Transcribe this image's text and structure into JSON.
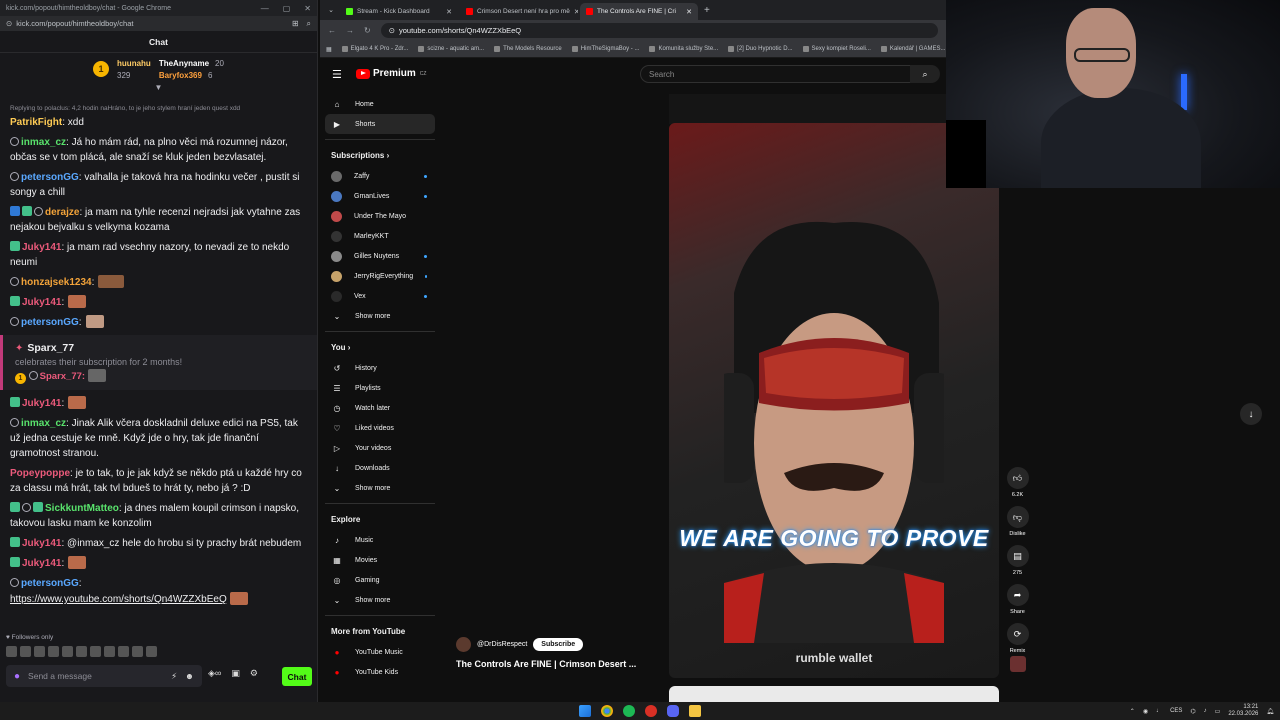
{
  "chat_window": {
    "title": "kick.com/popout/himtheoldboy/chat - Google Chrome",
    "url": "kick.com/popout/himtheoldboy/chat",
    "heading": "Chat",
    "leaderboard": {
      "gifter1": {
        "name": "huunahu",
        "points": "329"
      },
      "gifter2": {
        "name": "TheAnyname",
        "points": "20"
      },
      "gifter3": {
        "name": "Baryfox369",
        "points": "6"
      },
      "medal": "1"
    },
    "reply_note": "Replying to polaclus: 4,2 hodin naHráno, to je jeho stylem hraní jeden quest xdd",
    "messages": [
      {
        "user": "PatrikFight",
        "color": "#ffcc55",
        "text": " xdd"
      },
      {
        "user": "inmax_cz",
        "color": "#59e36c",
        "text": " Já ho mám rád, na plno věci má rozumnej názor, občas se v tom plácá, ale snaží se kluk jeden bezvlasatej."
      },
      {
        "user": "petersonGG",
        "color": "#5aa8ff",
        "text": " valhalla je taková hra na hodinku večer , pustit si songy a chill"
      },
      {
        "user": "derajze",
        "color": "#f2a33a",
        "text": " ja mam na tyhle recenzi nejradsi jak vytahne zas nejakou bejvalku s velkyma kozama"
      },
      {
        "user": "Juky141",
        "color": "#eb5a7b",
        "text": " ja mam rad vsechny nazory, to nevadi ze to nekdo neumi"
      },
      {
        "user": "honzajsek1234",
        "color": "#f2a33a",
        "text": ""
      },
      {
        "user": "Juky141",
        "color": "#eb5a7b",
        "text": ""
      },
      {
        "user": "petersonGG",
        "color": "#5aa8ff",
        "text": ""
      }
    ],
    "sub_event": {
      "user": "Sparx_77",
      "desc": "celebrates their subscription for 2 months!",
      "line_user": "Sparx_77",
      "medal": "1"
    },
    "messages2": [
      {
        "user": "Juky141",
        "color": "#eb5a7b",
        "text": ""
      },
      {
        "user": "inmax_cz",
        "color": "#59e36c",
        "text": " Jinak Alik včera doskladnil deluxe edici na PS5, tak už jedna cestuje ke mně. Když jde o hry, tak jde finanční gramotnost stranou."
      },
      {
        "user": "Popeypoppe",
        "color": "#eb5a7b",
        "text": " je to tak, to je jak když se někdo ptá u každé hry co za classu má hrát, tak tvl bdueš to hrát ty, nebo já ? :D"
      },
      {
        "user": "SickkuntMatteo",
        "color": "#59e36c",
        "text": " ja dnes malem koupil crimson i napsko, takovou lasku mam ke konzolim"
      },
      {
        "user": "Juky141",
        "color": "#eb5a7b",
        "text": " @inmax_cz hele do hrobu si ty prachy brát nebudem"
      },
      {
        "user": "Juky141",
        "color": "#eb5a7b",
        "text": ""
      },
      {
        "user": "petersonGG",
        "color": "#5aa8ff",
        "text": ""
      }
    ],
    "link": "https://www.youtube.com/shorts/Qn4WZZXbEeQ",
    "followers_only": "Followers only",
    "input_placeholder": "Send a message",
    "chat_button": "Chat"
  },
  "browser": {
    "tabs": [
      {
        "label": "Stream - Kick Dashboard",
        "color": "#53fc18"
      },
      {
        "label": "Crimson Desert není hra pro mě",
        "color": "#ff0000"
      },
      {
        "label": "The Controls Are FINE | Cri",
        "color": "#ff0000"
      }
    ],
    "url": "youtube.com/shorts/Qn4WZZXbEeQ",
    "bookmarks": [
      "Elgato 4 K Pro - Zdr...",
      "scizne - aquatic am...",
      "The Models Resource",
      "HimTheSigmaBoy - ...",
      "Komunita služby Ste...",
      "[2] Duo Hypnotic D...",
      "Sexy kompiet Roseli...",
      "Kalendář | GAMES..."
    ]
  },
  "youtube": {
    "logo": "Premium",
    "logo_region": "CZ",
    "search_placeholder": "Search",
    "nav": [
      {
        "label": "Home",
        "icon": "⌂"
      },
      {
        "label": "Shorts",
        "icon": "▶"
      }
    ],
    "subscriptions_header": "Subscriptions  ›",
    "subscriptions": [
      "Zaffy",
      "GmanLives",
      "Under The Mayo",
      "MarleyKKT",
      "Gilles Nuytens",
      "JerryRigEverything",
      "Vex"
    ],
    "show_more": "Show more",
    "you_header": "You  ›",
    "you_items": [
      {
        "label": "History",
        "icon": "↺"
      },
      {
        "label": "Playlists",
        "icon": "☰"
      },
      {
        "label": "Watch later",
        "icon": "◷"
      },
      {
        "label": "Liked videos",
        "icon": "♡"
      },
      {
        "label": "Your videos",
        "icon": "▷"
      },
      {
        "label": "Downloads",
        "icon": "↓"
      }
    ],
    "explore_header": "Explore",
    "explore_items": [
      {
        "label": "Music",
        "icon": "♪"
      },
      {
        "label": "Movies",
        "icon": "▦"
      },
      {
        "label": "Gaming",
        "icon": "◎"
      }
    ],
    "more_header": "More from YouTube",
    "more_items": [
      "YouTube Music",
      "YouTube Kids"
    ],
    "short": {
      "caption": "WE ARE GOING TO PROVE",
      "watermark": "rumble wallet",
      "channel": "@DrDisRespect",
      "subscribe": "Subscribe",
      "title": "The Controls Are FINE | Crimson Desert ..."
    },
    "actions": {
      "likes": "6.2K",
      "dislike": "Dislike",
      "comments": "275",
      "share": "Share",
      "remix": "Remix"
    }
  },
  "taskbar": {
    "time": "13:21",
    "date": "22.03.2026",
    "lang": "CES"
  }
}
